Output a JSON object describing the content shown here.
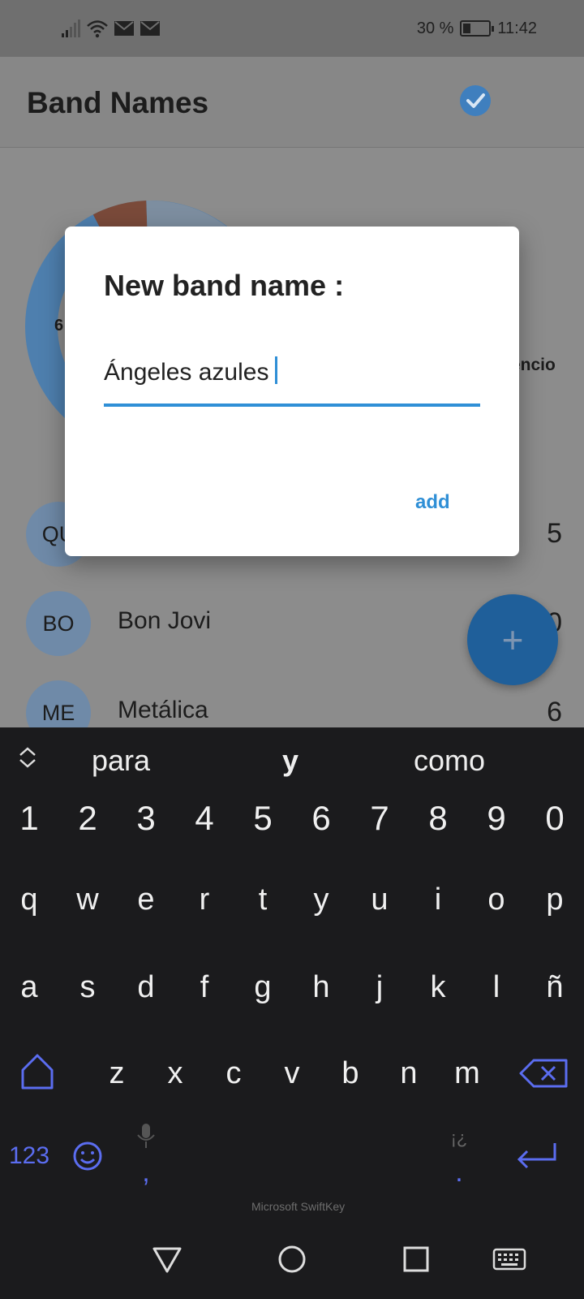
{
  "status_bar": {
    "icons": [
      "signal-icon",
      "wifi-icon",
      "mail-icon",
      "mail-icon"
    ],
    "battery_percent_text": "30 %",
    "battery_level": 0.3,
    "time": "11:42"
  },
  "app_bar": {
    "title": "Band Names",
    "status_icon": "check-circle-icon"
  },
  "content": {
    "donut_value_fragment": "6",
    "legend_fragment": "encio",
    "bands": [
      {
        "initials": "QU",
        "name": "",
        "votes": "5"
      },
      {
        "initials": "BO",
        "name": "Bon Jovi",
        "votes": "0"
      },
      {
        "initials": "ME",
        "name": "Metálica",
        "votes": "6"
      }
    ],
    "fab_label": "+"
  },
  "dialog": {
    "title": "New band name :",
    "input_value": "Ángeles azules",
    "action_label": "add"
  },
  "keyboard": {
    "suggestions": [
      "para",
      "y",
      "como"
    ],
    "number_row": [
      "1",
      "2",
      "3",
      "4",
      "5",
      "6",
      "7",
      "8",
      "9",
      "0"
    ],
    "row1": [
      "q",
      "w",
      "e",
      "r",
      "t",
      "y",
      "u",
      "i",
      "o",
      "p"
    ],
    "row2": [
      "a",
      "s",
      "d",
      "f",
      "g",
      "h",
      "j",
      "k",
      "l",
      "ñ"
    ],
    "row3": [
      "z",
      "x",
      "c",
      "v",
      "b",
      "n",
      "m"
    ],
    "symbols_key": "123",
    "comma_key": ",",
    "period_key": ".",
    "punct_hint": "¡¿",
    "brand": "Microsoft SwiftKey"
  },
  "colors": {
    "accent": "#2f8fd6",
    "keyboard_accent": "#5b6df0",
    "fab": "#1f5f9a"
  }
}
